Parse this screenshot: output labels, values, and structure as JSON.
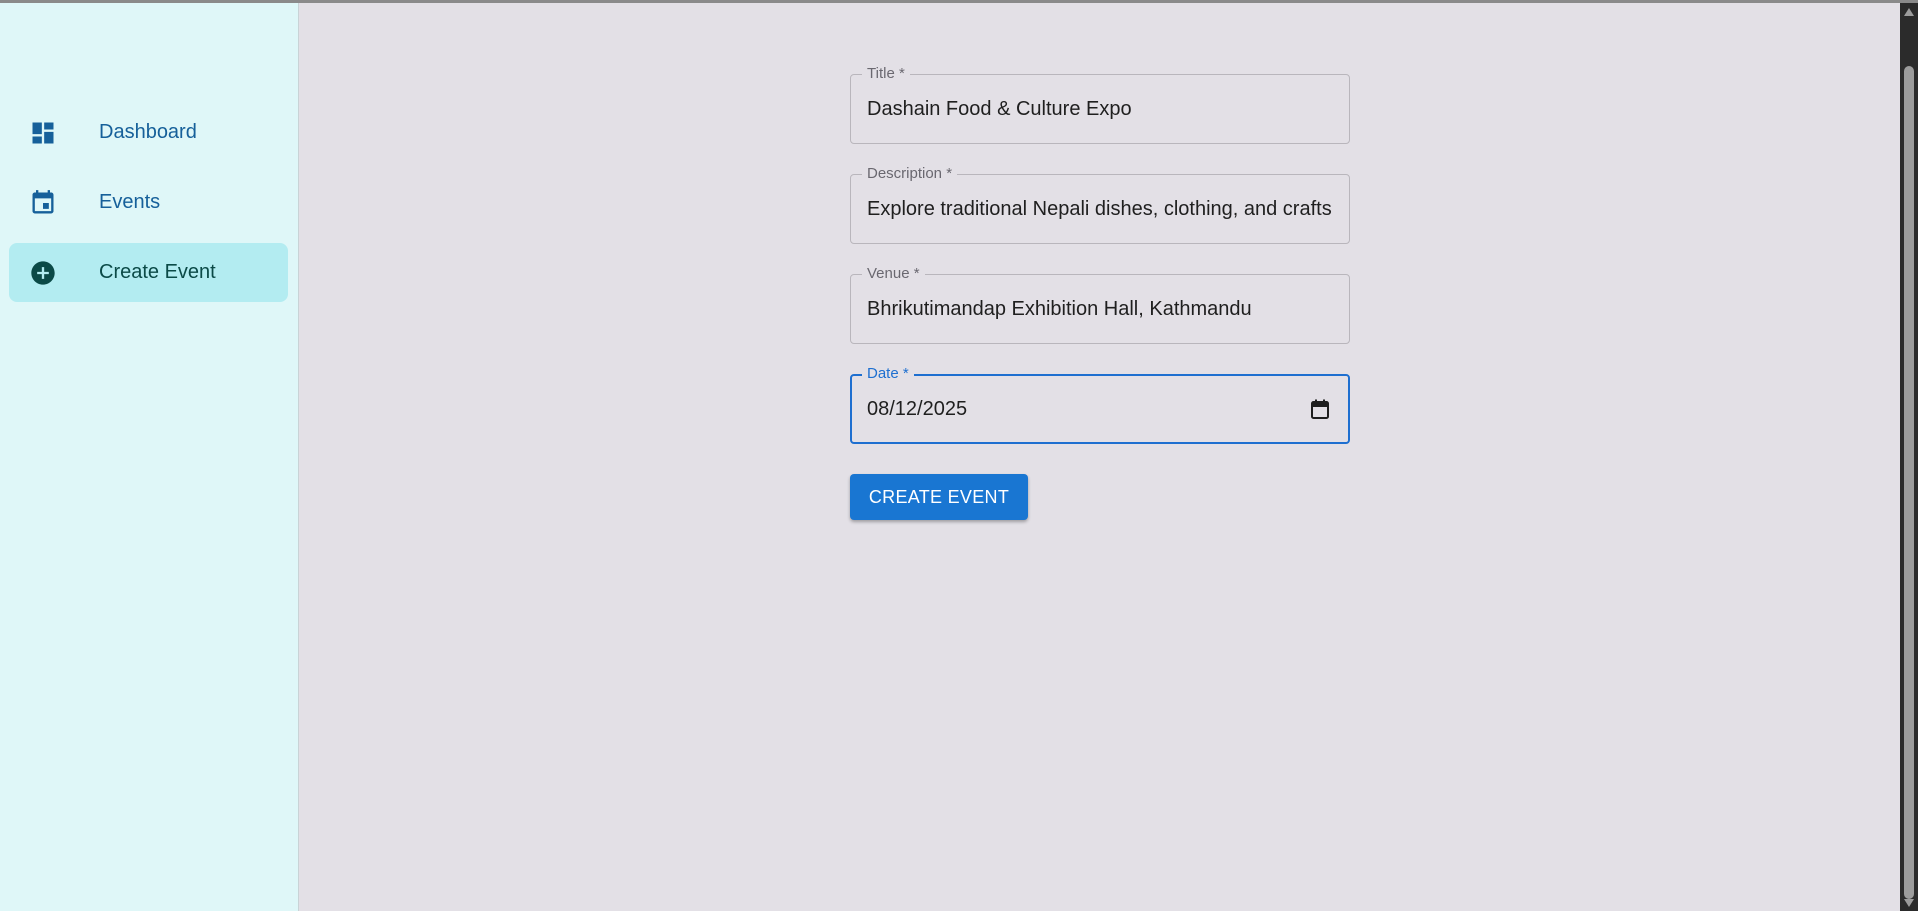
{
  "sidebar": {
    "items": [
      {
        "label": "Dashboard",
        "icon": "dashboard-icon",
        "active": false
      },
      {
        "label": "Events",
        "icon": "calendar-icon",
        "active": false
      },
      {
        "label": "Create Event",
        "icon": "add-circle-icon",
        "active": true
      }
    ]
  },
  "form": {
    "title": {
      "label": "Title *",
      "value": "Dashain Food & Culture Expo"
    },
    "description": {
      "label": "Description *",
      "value": "Explore traditional Nepali dishes, clothing, and crafts"
    },
    "venue": {
      "label": "Venue *",
      "value": "Bhrikutimandap Exhibition Hall, Kathmandu"
    },
    "date": {
      "label": "Date *",
      "value": "08/12/2025",
      "icon": "calendar-picker-icon"
    },
    "submit_label": "CREATE EVENT"
  },
  "colors": {
    "sidebar_bg": "#dff7f8",
    "active_item_bg": "#b3ecf1",
    "nav_text": "#16609a",
    "active_text": "#0b4a47",
    "content_bg": "#e3e0e6",
    "primary": "#1976d2"
  }
}
